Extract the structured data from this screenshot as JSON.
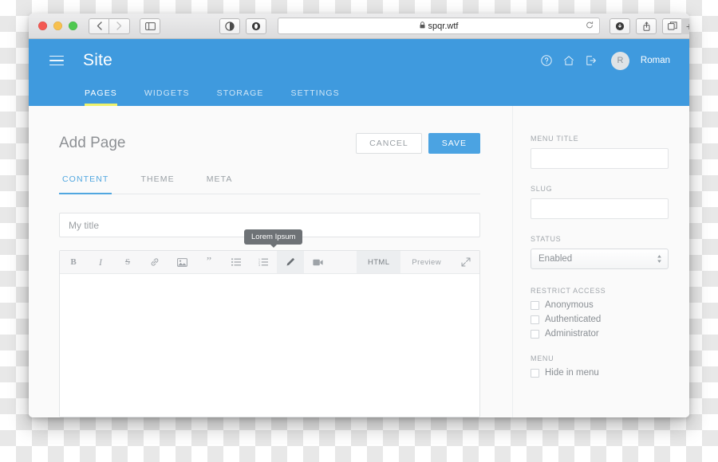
{
  "browser": {
    "url": "spqr.wtf",
    "lock_icon": "lock-icon",
    "reload_icon": "reload-icon",
    "back_icon": "chevron-left-icon",
    "forward_icon": "chevron-right-icon",
    "sidebar_icon": "sidebar-toggle-icon",
    "reader_icon": "reader-view-icon",
    "shield_icon": "shield-icon",
    "download_icon": "download-icon",
    "share_icon": "share-icon",
    "tabs_icon": "show-tabs-icon",
    "new_tab_label": "+"
  },
  "app": {
    "title": "Site",
    "menu_icon": "hamburger-icon",
    "header_icons": {
      "help": "help-circle-icon",
      "home": "home-icon",
      "logout": "logout-icon"
    },
    "user": {
      "initial": "R",
      "name": "Roman"
    },
    "accent_blue": "#3f9ade",
    "accent_yellow": "#eef26b",
    "tabs": [
      {
        "label": "PAGES",
        "active": true
      },
      {
        "label": "WIDGETS",
        "active": false
      },
      {
        "label": "STORAGE",
        "active": false
      },
      {
        "label": "SETTINGS",
        "active": false
      }
    ]
  },
  "page": {
    "title": "Add Page",
    "cancel_label": "CANCEL",
    "save_label": "SAVE",
    "save_color": "#4ba3e2",
    "subtabs": [
      {
        "label": "CONTENT",
        "active": true
      },
      {
        "label": "THEME",
        "active": false
      },
      {
        "label": "META",
        "active": false
      }
    ]
  },
  "editor": {
    "title_placeholder": "My title",
    "tooltip": "Lorem Ipsum",
    "toolbar": [
      {
        "name": "bold-icon",
        "glyph": "B"
      },
      {
        "name": "italic-icon",
        "glyph": "I"
      },
      {
        "name": "strikethrough-icon",
        "glyph": "S"
      },
      {
        "name": "link-icon",
        "glyph": "link"
      },
      {
        "name": "image-icon",
        "glyph": "image"
      },
      {
        "name": "quote-icon",
        "glyph": "”"
      },
      {
        "name": "bullet-list-icon",
        "glyph": "list"
      },
      {
        "name": "numbered-list-icon",
        "glyph": "olist"
      },
      {
        "name": "pencil-icon",
        "glyph": "pencil",
        "active": true
      },
      {
        "name": "video-icon",
        "glyph": "video"
      }
    ],
    "html_label": "HTML",
    "preview_label": "Preview",
    "expand_icon": "expand-arrows-icon",
    "body_text": ""
  },
  "sidebar": {
    "menu_title_label": "MENU TITLE",
    "menu_title_value": "",
    "slug_label": "SLUG",
    "slug_value": "",
    "status_label": "STATUS",
    "status_value": "Enabled",
    "restrict_label": "RESTRICT ACCESS",
    "restrict_options": [
      {
        "label": "Anonymous",
        "checked": false
      },
      {
        "label": "Authenticated",
        "checked": false
      },
      {
        "label": "Administrator",
        "checked": false
      }
    ],
    "menu_label": "MENU",
    "menu_options": [
      {
        "label": "Hide in menu",
        "checked": false
      }
    ]
  }
}
